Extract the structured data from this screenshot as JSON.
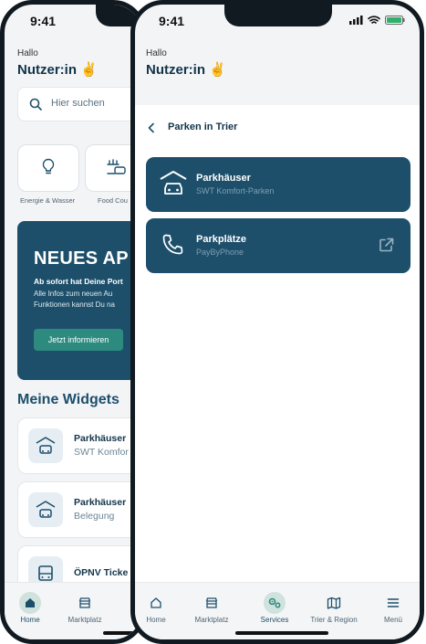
{
  "status": {
    "time": "9:41"
  },
  "greeting": {
    "hello": "Hallo",
    "name": "Nutzer:in ✌️"
  },
  "search": {
    "placeholder": "Hier suchen"
  },
  "tiles": [
    {
      "label": "Energie & Wasser"
    },
    {
      "label": "Food Cou"
    }
  ],
  "banner": {
    "title": "NEUES AP",
    "line1": "Ab sofort hat Deine Port",
    "line2": "Alle Infos zum neuen Au",
    "line3": "Funktionen kannst Du na",
    "cta": "Jetzt informieren"
  },
  "widgets": {
    "title": "Meine Widgets",
    "items": [
      {
        "title": "Parkhäuser",
        "subtitle": "SWT Komfor"
      },
      {
        "title": "Parkhäuser",
        "subtitle": "Belegung"
      },
      {
        "title": "ÖPNV Ticke",
        "subtitle": ""
      }
    ]
  },
  "back_tabs": [
    {
      "label": "Home"
    },
    {
      "label": "Marktplatz"
    }
  ],
  "parking": {
    "header": "Parken in Trier",
    "items": [
      {
        "title": "Parkhäuser",
        "subtitle": "SWT Komfort-Parken"
      },
      {
        "title": "Parkplätze",
        "subtitle": "PayByPhone"
      }
    ]
  },
  "front_tabs": [
    {
      "label": "Home"
    },
    {
      "label": "Marktplatz"
    },
    {
      "label": "Services"
    },
    {
      "label": "Trier & Region"
    },
    {
      "label": "Menü"
    }
  ],
  "colors": {
    "primary": "#1d4f6b",
    "accent": "#2d8a7f",
    "active_tab_bg": "#cfe2dd"
  }
}
